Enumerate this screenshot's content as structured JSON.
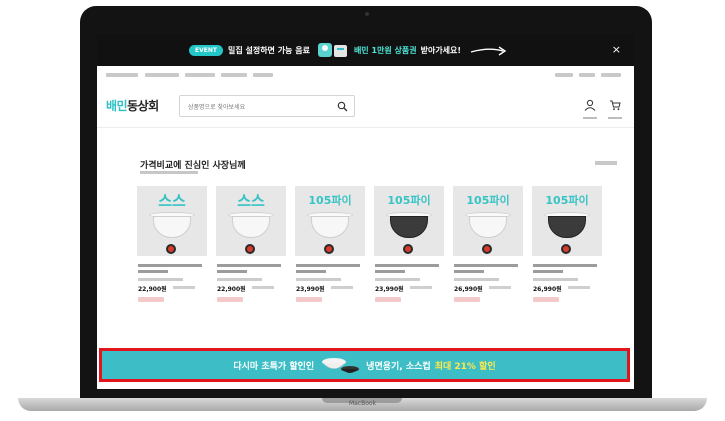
{
  "device": {
    "base_label": "MacBook"
  },
  "event_banner": {
    "pill": "EVENT",
    "text_1": "밀집 설정하면 가능 음료",
    "text_2": "배민 1만원 상품권",
    "text_3": "받아가세요!",
    "close": "×",
    "colors": {
      "background": "#111111",
      "accent": "#4ee7d8"
    }
  },
  "header": {
    "logo_part1": "배민",
    "logo_part2": "동상회",
    "search_placeholder": "상품명으로 찾아보세요",
    "icons": [
      "search-icon",
      "user-icon",
      "cart-icon"
    ]
  },
  "section": {
    "title": "가격비교에 진심인 사장님께"
  },
  "products": [
    {
      "brand": "스스",
      "price": "22,900원",
      "bowl": "white"
    },
    {
      "brand": "스스",
      "price": "22,900원",
      "bowl": "white"
    },
    {
      "brand": "105파이",
      "price": "23,990원",
      "bowl": "white"
    },
    {
      "brand": "105파이",
      "price": "23,990원",
      "bowl": "dark"
    },
    {
      "brand": "105파이",
      "price": "26,990원",
      "bowl": "white"
    },
    {
      "brand": "105파이",
      "price": "26,990원",
      "bowl": "dark"
    }
  ],
  "promo_banner": {
    "text_1": "다시마 초특가 할인인",
    "text_2": "냉면용기, 소스컵",
    "text_3": "최대 21% 할인",
    "colors": {
      "background": "#3dbec6",
      "border": "#e0161c",
      "highlight": "#ffe84a"
    }
  }
}
